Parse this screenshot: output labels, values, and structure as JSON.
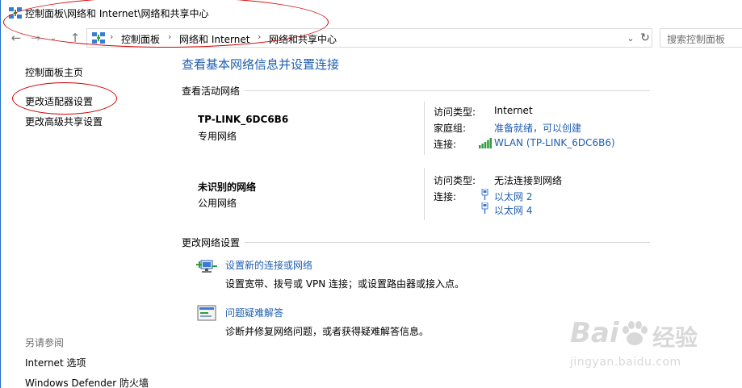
{
  "window": {
    "title": "控制面板\\网络和 Internet\\网络和共享中心"
  },
  "address_bar": {
    "crumbs": [
      "控制面板",
      "网络和 Internet",
      "网络和共享中心"
    ],
    "search_placeholder": "搜索控制面板"
  },
  "sidebar": {
    "items": [
      {
        "label": "控制面板主页"
      },
      {
        "label": "更改适配器设置"
      },
      {
        "label": "更改高级共享设置"
      }
    ],
    "see_also_title": "另请参阅",
    "see_also": [
      {
        "label": "Internet 选项"
      },
      {
        "label": "Windows Defender 防火墙"
      }
    ]
  },
  "main": {
    "heading": "查看基本网络信息并设置连接",
    "active_networks_label": "查看活动网络",
    "networks": [
      {
        "name": "TP-LINK_6DC6B6",
        "type": "专用网络",
        "access_type_key": "访问类型:",
        "access_type_value": "Internet",
        "homegroup_key": "家庭组:",
        "homegroup_value": "准备就绪，可以创建",
        "connection_key": "连接:",
        "connection_value": "WLAN (TP-LINK_6DC6B6)"
      },
      {
        "name": "未识别的网络",
        "type": "公用网络",
        "access_type_key": "访问类型:",
        "access_type_value": "无法连接到网络",
        "connection_key": "连接:",
        "connections": [
          "以太网 2",
          "以太网 4"
        ]
      }
    ],
    "change_settings_label": "更改网络设置",
    "tasks": [
      {
        "link": "设置新的连接或网络",
        "desc": "设置宽带、拨号或 VPN 连接；或设置路由器或接入点。",
        "icon": "network-setup-icon"
      },
      {
        "link": "问题疑难解答",
        "desc": "诊断并修复网络问题，或者获得疑难解答信息。",
        "icon": "troubleshoot-icon"
      }
    ]
  },
  "watermark": {
    "brand": "Bai",
    "brand_suffix": "经验",
    "url": "jingyan.baidu.com"
  },
  "colors": {
    "link": "#1e5eb0",
    "annotation": "#d40000"
  }
}
